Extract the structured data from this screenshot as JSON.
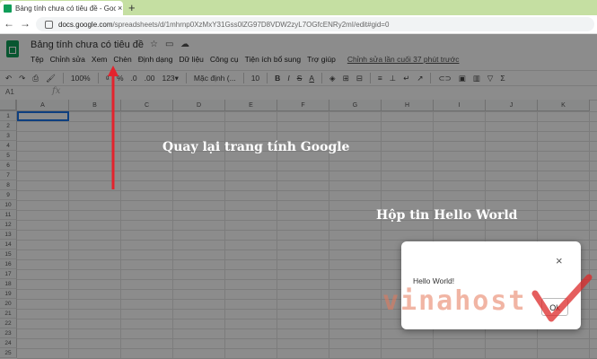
{
  "browser": {
    "tab_title": "Bảng tính chưa có tiêu đề - Goo",
    "tab_close": "×",
    "new_tab": "+",
    "back": "←",
    "forward": "→",
    "url_host": "docs.google.com",
    "url_path": "/spreadsheets/d/1mhrnp0XzMxY31Gss0lZG97D8VDW2zyL7OGfcENRy2mI/edit#gid=0"
  },
  "doc": {
    "title": "Bảng tính chưa có tiêu đề",
    "star_icon": "☆",
    "folder_icon": "▭",
    "cloud_icon": "☁",
    "menus": [
      "Tệp",
      "Chỉnh sửa",
      "Xem",
      "Chèn",
      "Định dạng",
      "Dữ liệu",
      "Công cụ",
      "Tiện ích bổ sung",
      "Trợ giúp"
    ],
    "last_edit": "Chỉnh sửa lần cuối 37 phút trước"
  },
  "toolbar": {
    "undo": "↶",
    "redo": "↷",
    "print": "⎙",
    "paint": "🖌",
    "zoom": "100%",
    "currency": "₫",
    "percent": "%",
    "dec_less": ".0",
    "dec_more": ".00",
    "more_formats": "123▾",
    "font": "Mặc định (...",
    "font_size": "10",
    "bold": "B",
    "italic": "I",
    "strike": "S",
    "text_color": "A",
    "fill": "◈",
    "borders": "⊞",
    "merge": "⊟",
    "halign": "≡",
    "valign": "⊥",
    "wrap": "↵",
    "rotate": "↗",
    "link": "⊂⊃",
    "comment": "▣",
    "chart": "▥",
    "filter": "▽",
    "functions": "Σ"
  },
  "formula": {
    "name_box": "A1",
    "fx": "fx"
  },
  "grid": {
    "columns": [
      "A",
      "B",
      "C",
      "D",
      "E",
      "F",
      "G",
      "H",
      "I",
      "J",
      "K"
    ],
    "rows": [
      "1",
      "2",
      "3",
      "4",
      "5",
      "6",
      "7",
      "8",
      "9",
      "10",
      "11",
      "12",
      "13",
      "14",
      "15",
      "16",
      "17",
      "18",
      "19",
      "20",
      "21",
      "22",
      "23",
      "24",
      "25"
    ]
  },
  "annotations": {
    "back_note": "Quay lại trang tính Google",
    "dialog_note": "Hộp tin Hello World",
    "arrow_color": "#e3232d"
  },
  "dialog": {
    "message": "Hello World!",
    "ok_label": "Ok",
    "close": "×"
  },
  "watermark": {
    "text": "vinahost"
  }
}
